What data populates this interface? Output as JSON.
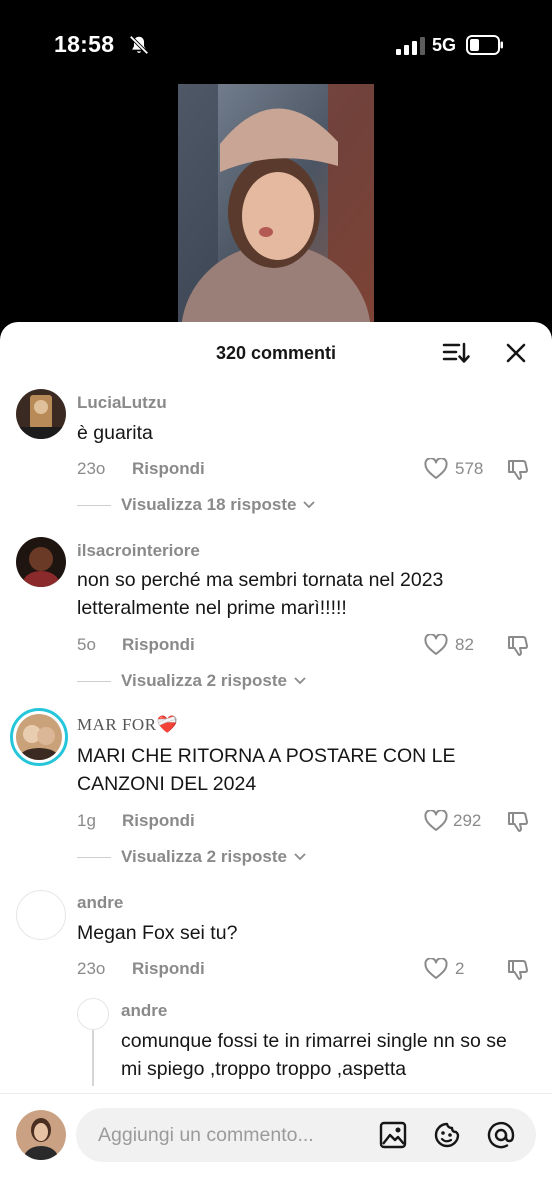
{
  "status_bar": {
    "time": "18:58",
    "network": "5G"
  },
  "comments_header": {
    "count_label": "320 commenti"
  },
  "comments": [
    {
      "username": "LuciaLutzu",
      "text": "è guarita",
      "time": "23o",
      "reply_label": "Rispondi",
      "likes": "578",
      "view_replies": "Visualizza 18 risposte"
    },
    {
      "username": "ilsacrointeriore",
      "text": "non so perché ma sembri tornata nel 2023 letteralmente nel prime marì!!!!!",
      "time": "5o",
      "reply_label": "Rispondi",
      "likes": "82",
      "view_replies": "Visualizza 2 risposte"
    },
    {
      "username": "MAR FOR❤️‍🩹",
      "text": "MARI CHE RITORNA A POSTARE CON LE CANZONI DEL 2024",
      "time": "1g",
      "reply_label": "Rispondi",
      "likes": "292",
      "view_replies": "Visualizza 2 risposte"
    },
    {
      "username": "andre",
      "text": "Megan Fox sei tu?",
      "time": "23o",
      "reply_label": "Rispondi",
      "likes": "2"
    }
  ],
  "nested_reply": {
    "username": "andre",
    "text": "comunque fossi te in rimarrei single nn so se mi spiego ,troppo troppo ,aspetta"
  },
  "input": {
    "placeholder": "Aggiungi un commento..."
  },
  "icons": {
    "bell": "bell-slash-icon",
    "sort": "sort-icon",
    "close": "close-icon",
    "like": "heart-icon",
    "dislike": "thumbs-down-icon",
    "chevron": "chevron-down-icon",
    "image": "image-icon",
    "emoji": "emoji-icon",
    "mention": "at-icon"
  }
}
